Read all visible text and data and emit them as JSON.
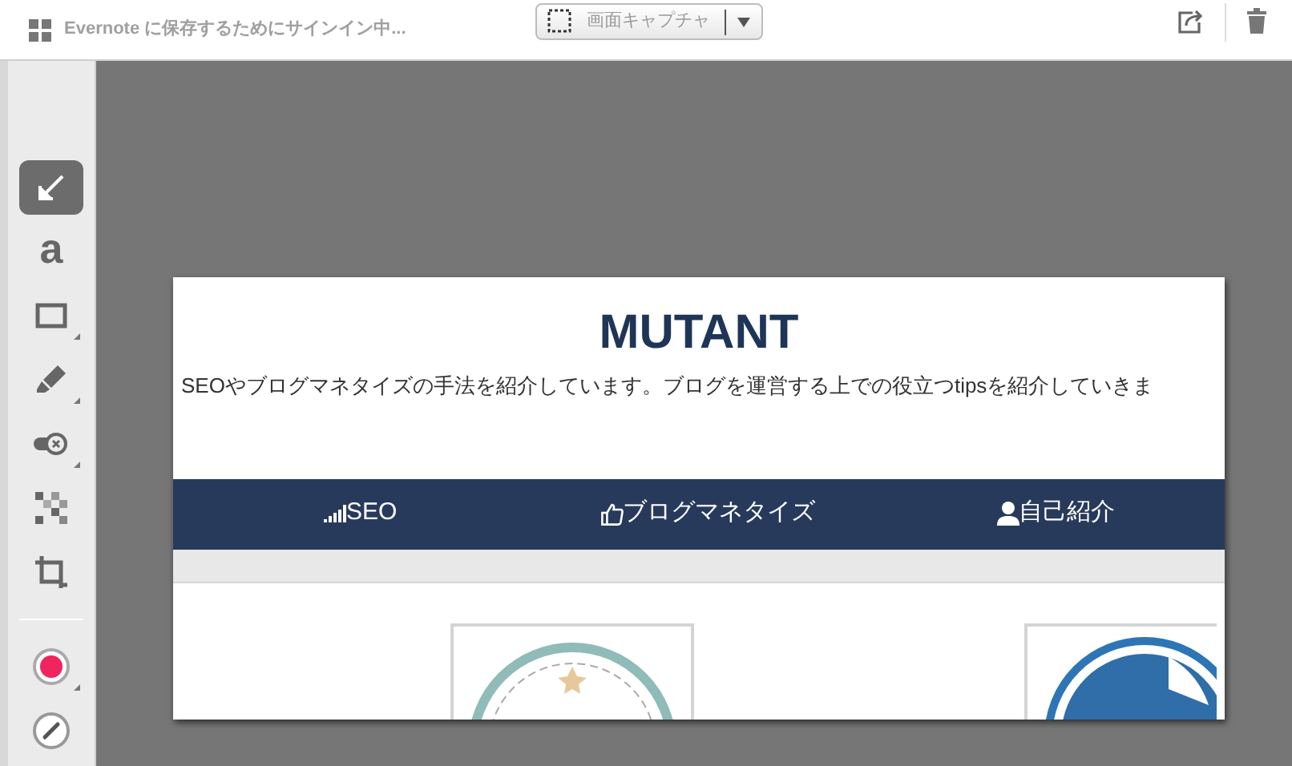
{
  "top_bar": {
    "title": "Evernote に保存するためにサインイン中...",
    "capture_button": {
      "label": "画面キャプチャ"
    }
  },
  "tools": [
    {
      "kind": "arrow",
      "selected": true
    },
    {
      "kind": "text",
      "label": "a",
      "selected": false
    },
    {
      "kind": "rectangle",
      "selected": false
    },
    {
      "kind": "highlighter",
      "selected": false
    },
    {
      "kind": "eraser",
      "selected": false
    },
    {
      "kind": "pixelate",
      "selected": false
    },
    {
      "kind": "crop",
      "selected": false
    },
    {
      "kind": "divider"
    },
    {
      "kind": "color",
      "color": "#f0245e",
      "selected": false
    },
    {
      "kind": "line-width",
      "selected": false
    }
  ],
  "captured_page": {
    "title": "MUTANT",
    "tagline": "SEOやブログマネタイズの手法を紹介しています。ブログを運営する上での役立つtipsを紹介していきま",
    "nav": [
      {
        "kind": "signal",
        "label": "SEO"
      },
      {
        "kind": "thumb",
        "label": "ブログマネタイズ"
      },
      {
        "kind": "person",
        "label": "自己紹介"
      }
    ]
  }
}
